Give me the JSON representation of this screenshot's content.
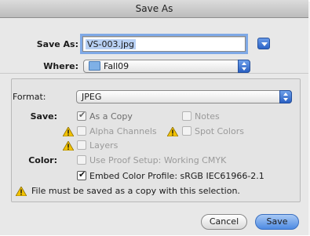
{
  "dialog": {
    "title": "Save As",
    "save_as_label": "Save As:",
    "filename": "VS-003.jpg",
    "where_label": "Where:",
    "where_value": "Fall09"
  },
  "options": {
    "format_label": "Format:",
    "format_value": "JPEG",
    "save_label": "Save:",
    "as_a_copy": "As a Copy",
    "notes": "Notes",
    "alpha_channels": "Alpha Channels",
    "spot_colors": "Spot Colors",
    "layers": "Layers",
    "color_label": "Color:",
    "use_proof_setup": "Use Proof Setup:  Working CMYK",
    "embed_color_profile": "Embed Color Profile:  sRGB IEC61966-2.1",
    "warning_text": "File must be saved as a copy with this selection."
  },
  "checkbox_states": {
    "as_a_copy": true,
    "notes": false,
    "alpha_channels": false,
    "spot_colors": false,
    "layers": false,
    "use_proof_setup": false,
    "embed_color_profile": true
  },
  "buttons": {
    "cancel": "Cancel",
    "save": "Save"
  },
  "icons": {
    "disclosure": "disclosure-triangle-icon",
    "folder": "folder-icon",
    "warning": "warning-triangle-icon"
  },
  "colors": {
    "accent": "#3a7ae0",
    "warning": "#f2c200"
  }
}
